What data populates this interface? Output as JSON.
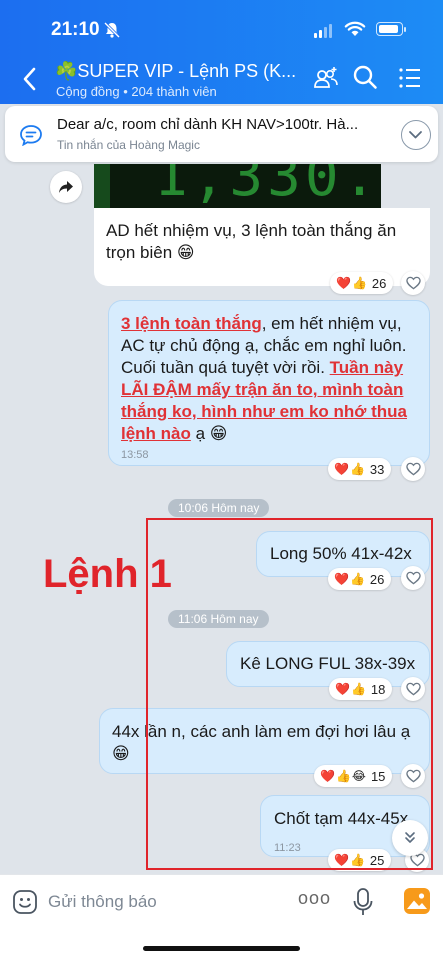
{
  "status_bar": {
    "time": "21:10"
  },
  "header": {
    "title": "☘️SUPER VIP - Lệnh PS (K...",
    "subtitle": "Cộng đồng • 204 thành viên"
  },
  "pinned": {
    "text": "Dear a/c, room chỉ dành KH NAV>100tr. Hà...",
    "sender": "Tin nhắn của Hoàng Magic"
  },
  "messages": {
    "m1": {
      "text": "AD hết nhiệm vụ, 3 lệnh toàn thắng ăn trọn biên 😁",
      "reaction_count": "26"
    },
    "m2": {
      "part1_red": "3 lệnh toàn thắng",
      "part1_rest": ", em hết nhiệm vụ, AC tự chủ động ạ, chắc em nghỉ luôn. Cuối tuần quá tuyệt vời rồi.",
      "part2_red": "Tuần này LÃI ĐẬM mấy trận ăn to, mình toàn thắng ko, hình như em ko nhớ thua lệnh nào",
      "part2_rest": " ạ 😁",
      "time": "13:58",
      "reaction_count": "33"
    },
    "divider1": "10:06 Hôm nay",
    "m3": {
      "text": "Long 50% 41x-42x",
      "reaction_count": "26"
    },
    "divider2": "11:06 Hôm nay",
    "m4": {
      "text": "Kê LONG FUL 38x-39x",
      "reaction_count": "18"
    },
    "m5": {
      "text": "44x lần n, các anh làm em đợi hơi lâu ạ 😁",
      "reaction_count": "15"
    },
    "m6": {
      "text": "Chốt tạm 44x-45x",
      "time": "11:23",
      "reaction_count": "25"
    }
  },
  "annotation": {
    "label": "Lệnh 1",
    "color": "#e0242b"
  },
  "composer": {
    "placeholder": "Gửi thông báo",
    "more": "ooo"
  },
  "colors": {
    "header": "#1c6ef0",
    "bubble_out": "#d7ecfd",
    "bubble_in": "#ffffff"
  }
}
